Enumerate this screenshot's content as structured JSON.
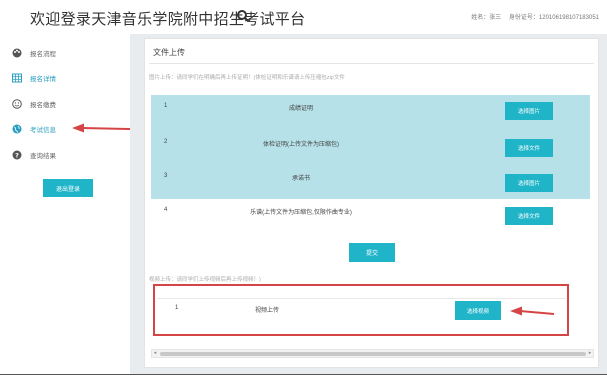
{
  "header": {
    "title": "欢迎登录天津音乐学院附中招生考试平台",
    "name_label": "姓名：张三",
    "id_label": "身份证号：120106198107183051"
  },
  "sidebar": {
    "items": [
      {
        "label": "报名流程",
        "icon": "palette-icon"
      },
      {
        "label": "报名详情",
        "icon": "table-icon"
      },
      {
        "label": "报名缴费",
        "icon": "smile-icon"
      },
      {
        "label": "考试信息",
        "icon": "globe-icon"
      },
      {
        "label": "查询结果",
        "icon": "question-icon"
      }
    ],
    "active_index": 3,
    "logout_label": "退出登录"
  },
  "panel": {
    "title": "文件上传",
    "image_hint": "图片上传：请同学们在明确后再上传证明！(体检证明和乐谱请上传压缩包zip文件",
    "rows": [
      {
        "num": "1",
        "name": "成绩证明",
        "button": "选择图片"
      },
      {
        "num": "2",
        "name": "体检证明(上传文件为压缩包)",
        "button": "选择文件"
      },
      {
        "num": "3",
        "name": "承诺书",
        "button": "选择图片"
      },
      {
        "num": "4",
        "name": "乐谱(上传文件为压缩包,仅限作曲专业)",
        "button": "选择文件"
      }
    ],
    "submit_label": "提交",
    "video_hint": "视频上传：请同学们上传视频后再上传视频！)",
    "video_row": {
      "num": "1",
      "name": "视频上传",
      "button": "选择视频"
    }
  },
  "colors": {
    "accent": "#20b4c8",
    "row_highlight": "#b6e1e8",
    "annotation": "#d64545",
    "active_nav": "#2a9ec0"
  }
}
